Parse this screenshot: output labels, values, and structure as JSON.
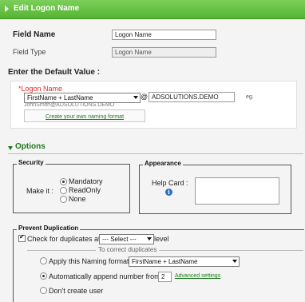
{
  "header": {
    "title": "Edit Logon Name"
  },
  "field_name": {
    "label": "Field Name",
    "value": "Logon Name"
  },
  "field_type": {
    "label": "Field Type",
    "value": "Logon Name"
  },
  "default_value": {
    "heading": "Enter the Default Value :",
    "required_marker": "*",
    "field_label": "Logon Name",
    "format_select": "FirstName + LastName",
    "at_sign": "@",
    "domain_value": "ADSOLUTIONS.DEMO",
    "eg_label": "eg.",
    "example": "JohnSmith@ADSOLUTIONS.DEMO",
    "create_format_link": "Create your own naming format"
  },
  "options": {
    "heading": "Options"
  },
  "security": {
    "legend": "Security",
    "make_it_label": "Make it :",
    "radios": [
      {
        "label": "Mandatory",
        "checked": true
      },
      {
        "label": "ReadOnly",
        "checked": false
      },
      {
        "label": "None",
        "checked": false
      }
    ]
  },
  "appearance": {
    "legend": "Appearance",
    "help_card_label": "Help Card :",
    "info_icon": "info-icon"
  },
  "prevent_duplication": {
    "legend": "Prevent Duplication",
    "check_label": "Check for duplicates at",
    "check_checked": true,
    "level_select": "--- Select ---",
    "level_label": "level",
    "to_correct_legend": "To correct duplicates",
    "apply_format_label": "Apply this Naming format",
    "apply_format_select": "FirstName + LastName",
    "append_label": "Automatically append number from",
    "append_value": "2",
    "advanced_link": "Advanced settings",
    "dont_create_label": "Don't create user",
    "selected_option": "append"
  },
  "colors": {
    "accent": "#54b531",
    "link": "#1e7a1e",
    "required": "#e03030"
  }
}
